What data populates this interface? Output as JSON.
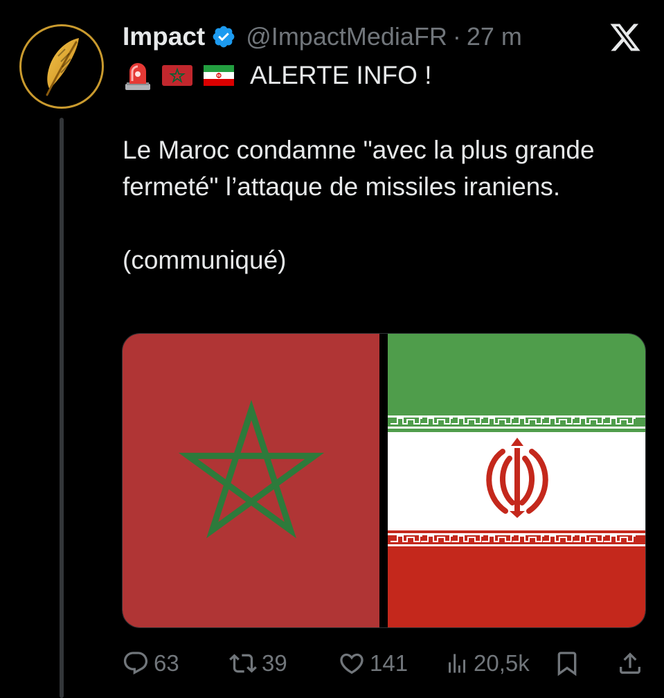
{
  "tweet": {
    "author_name": "Impact",
    "handle": "@ImpactMediaFR",
    "separator": "·",
    "time": "27 m",
    "alert": "ALERTE INFO !",
    "body_line1": "Le Maroc condamne \"avec la plus grande fermeté\" l’attaque de missiles iraniens.",
    "body_line2": "(communiqué)"
  },
  "actions": {
    "replies": "63",
    "retweets": "39",
    "likes": "141",
    "views": "20,5k"
  },
  "icons": {
    "avatar": "gold-feather-icon",
    "verified": "verified-badge-icon",
    "app_logo": "x-logo-icon",
    "alert_emojis": [
      "siren-emoji",
      "morocco-flag-emoji",
      "iran-flag-emoji"
    ],
    "actions": [
      "reply-icon",
      "retweet-icon",
      "like-icon",
      "views-icon",
      "bookmark-icon",
      "share-icon"
    ]
  },
  "colors": {
    "background": "#000000",
    "text": "#e7e9ea",
    "muted": "#71767b",
    "verified": "#1d9bf0",
    "gold": "#c99a2e",
    "morocco_red": "#b03535",
    "morocco_green": "#2d7a3b",
    "iran_green": "#4f9d4b",
    "iran_red": "#c4281c"
  }
}
